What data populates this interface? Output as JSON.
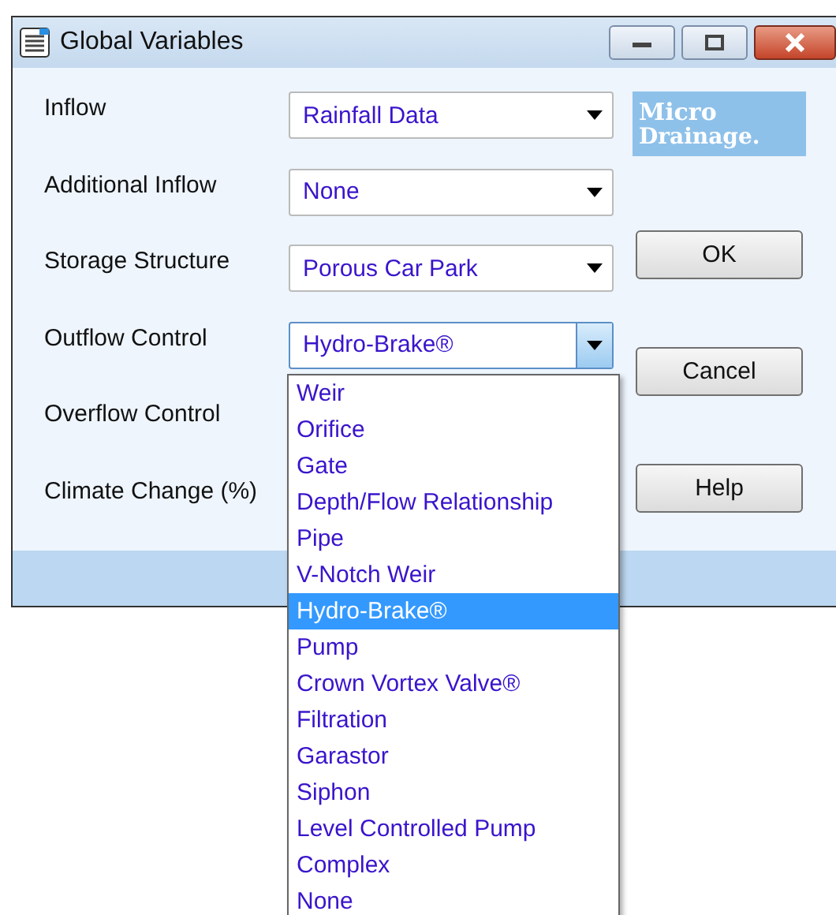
{
  "window": {
    "title": "Global Variables"
  },
  "fields": [
    {
      "label": "Inflow",
      "value": "Rainfall Data",
      "open": false
    },
    {
      "label": "Additional Inflow",
      "value": "None",
      "open": false
    },
    {
      "label": "Storage Structure",
      "value": "Porous Car Park",
      "open": false
    },
    {
      "label": "Outflow Control",
      "value": "Hydro-Brake®",
      "open": true
    },
    {
      "label": "Overflow Control"
    },
    {
      "label": "Climate Change (%)"
    }
  ],
  "logo": {
    "line_1": "Micro",
    "line_2": "Drainage."
  },
  "buttons": [
    "OK",
    "Cancel",
    "Help"
  ],
  "dropdown": {
    "items": [
      {
        "label": "Weir",
        "selected": false
      },
      {
        "label": "Orifice",
        "selected": false
      },
      {
        "label": "Gate",
        "selected": false
      },
      {
        "label": "Depth/Flow Relationship",
        "selected": false
      },
      {
        "label": "Pipe",
        "selected": false
      },
      {
        "label": "V-Notch Weir",
        "selected": false
      },
      {
        "label": "Hydro-Brake®",
        "selected": true
      },
      {
        "label": "Pump",
        "selected": false
      },
      {
        "label": "Crown Vortex Valve®",
        "selected": false
      },
      {
        "label": "Filtration",
        "selected": false
      },
      {
        "label": "Garastor",
        "selected": false
      },
      {
        "label": "Siphon",
        "selected": false
      },
      {
        "label": "Level Controlled Pump",
        "selected": false
      },
      {
        "label": "Complex",
        "selected": false
      },
      {
        "label": "None",
        "selected": false
      }
    ]
  }
}
